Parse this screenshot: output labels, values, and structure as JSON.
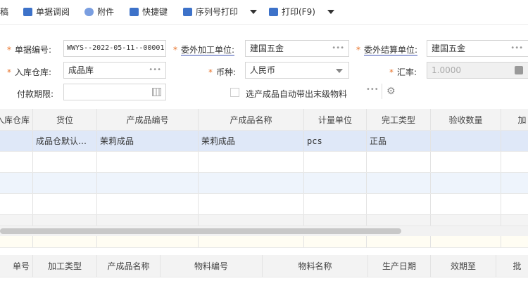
{
  "toolbar": {
    "items": [
      {
        "label": "稿",
        "icon": "draft-icon"
      },
      {
        "label": "单据调阅",
        "icon": "document-search-icon"
      },
      {
        "label": "附件",
        "icon": "paperclip-icon"
      },
      {
        "label": "快捷键",
        "icon": "keyboard-icon"
      },
      {
        "label": "序列号打印",
        "icon": "printer-icon",
        "dropdown": true
      },
      {
        "label": "打印(F9)",
        "icon": "printer-icon",
        "dropdown": true
      }
    ]
  },
  "form": {
    "doc_no": {
      "label": "单据编号:",
      "value": "WWYS--2022-05-11--00001"
    },
    "processor": {
      "label": "委外加工单位:",
      "value": "建国五金"
    },
    "settlement": {
      "label": "委外结算单位:",
      "value": "建国五金"
    },
    "warehouse": {
      "label": "入库仓库:",
      "value": "成品库"
    },
    "currency": {
      "label": "币种:",
      "value": "人民币"
    },
    "rate": {
      "label": "汇率:",
      "value": "1.0000"
    },
    "payment": {
      "label": "付款期限:",
      "value": ""
    },
    "auto_material": {
      "label": "选产成品自动带出末级物料",
      "checked": false
    }
  },
  "colors": {
    "accent": "#3d72c9",
    "required": "#e8742b",
    "selected_row": "#dfe8f8"
  },
  "top_table": {
    "headers": [
      "入库仓库",
      "货位",
      "产成品编号",
      "产成品名称",
      "计量单位",
      "完工类型",
      "验收数量",
      "加"
    ],
    "rows": [
      [
        "",
        "成品仓默认…",
        "茉莉成品",
        "茉莉成品",
        "pcs",
        "正品",
        "",
        ""
      ]
    ]
  },
  "bottom_table": {
    "headers": [
      "单号",
      "加工类型",
      "产成品名称",
      "物料编号",
      "物料名称",
      "生产日期",
      "效期至",
      "批"
    ]
  }
}
